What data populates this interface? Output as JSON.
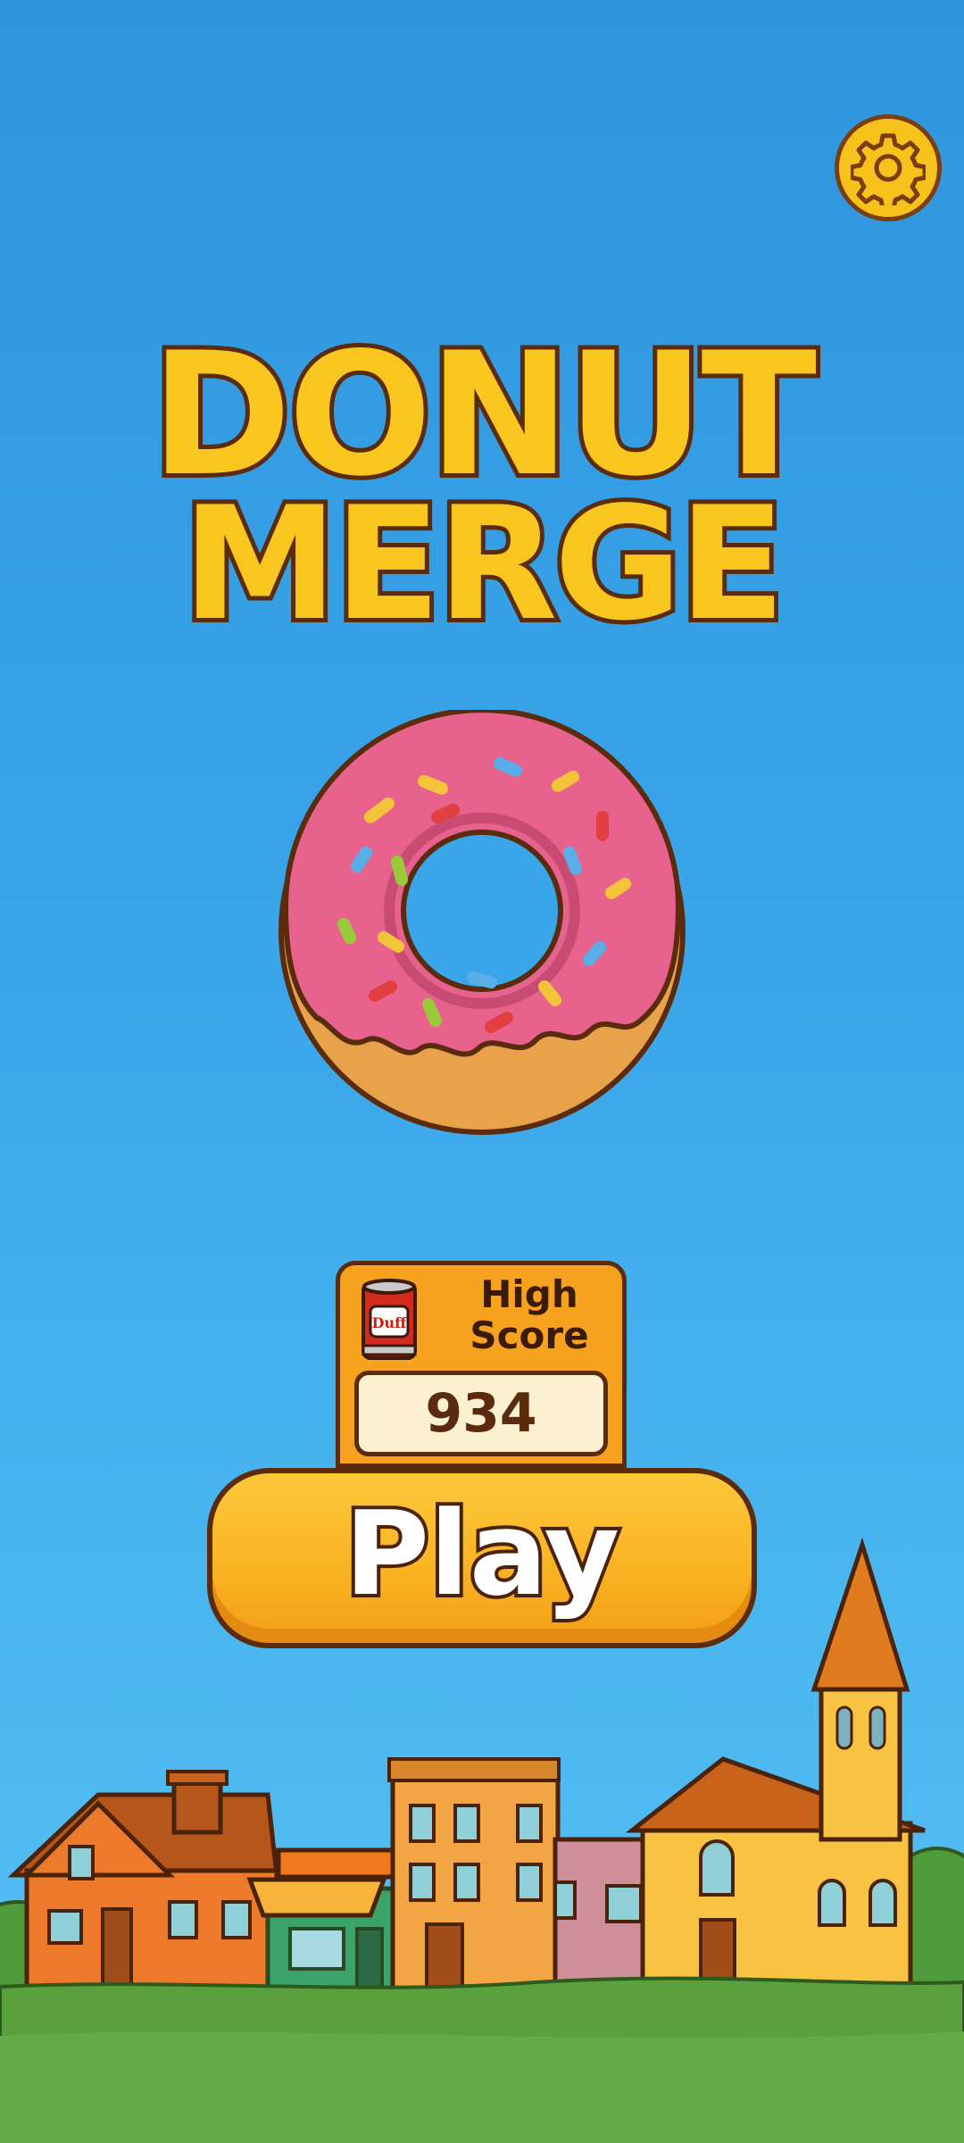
{
  "title": {
    "line1": "DONUT",
    "line2": "MERGE"
  },
  "settings": {
    "icon": "gear-icon"
  },
  "high_score": {
    "label": "High Score",
    "value": "934",
    "icon": "duff-can-icon",
    "can_label": "Duff"
  },
  "play": {
    "label": "Play"
  },
  "colors": {
    "sky": "#3aa6ea",
    "gold": "#f9c620",
    "outline": "#5a2c0d",
    "panel": "#f7a21e",
    "button": "#f9b222",
    "grass": "#5aa03c"
  }
}
